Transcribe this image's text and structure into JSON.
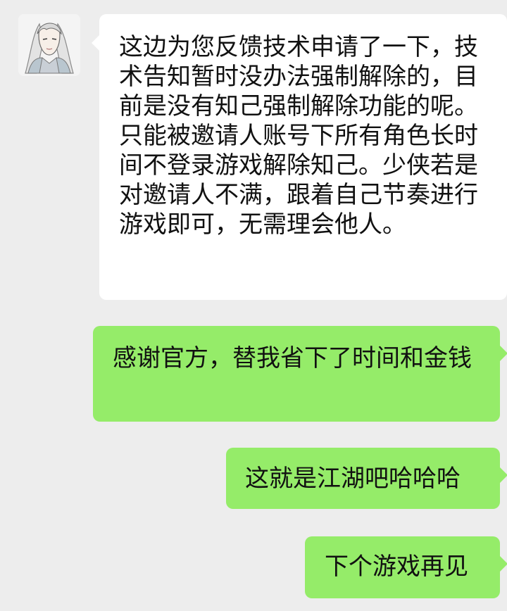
{
  "conversation": {
    "incoming": {
      "avatar_icon": "anime-character-avatar-icon",
      "text": "这边为您反馈技术申请了一下，技术告知暂时没办法强制解除的，目前是没有知己强制解除功能的呢。只能被邀请人账号下所有角色长时间不登录游戏解除知己。少侠若是对邀请人不满，跟着自己节奏进行游戏即可，无需理会他人。"
    },
    "outgoing": [
      {
        "text": "感谢官方，替我省下了时间和金钱"
      },
      {
        "text": "这就是江湖吧哈哈哈"
      },
      {
        "text": "下个游戏再见"
      }
    ]
  },
  "colors": {
    "background": "#ededed",
    "incoming_bubble": "#ffffff",
    "outgoing_bubble": "#95ec69"
  }
}
